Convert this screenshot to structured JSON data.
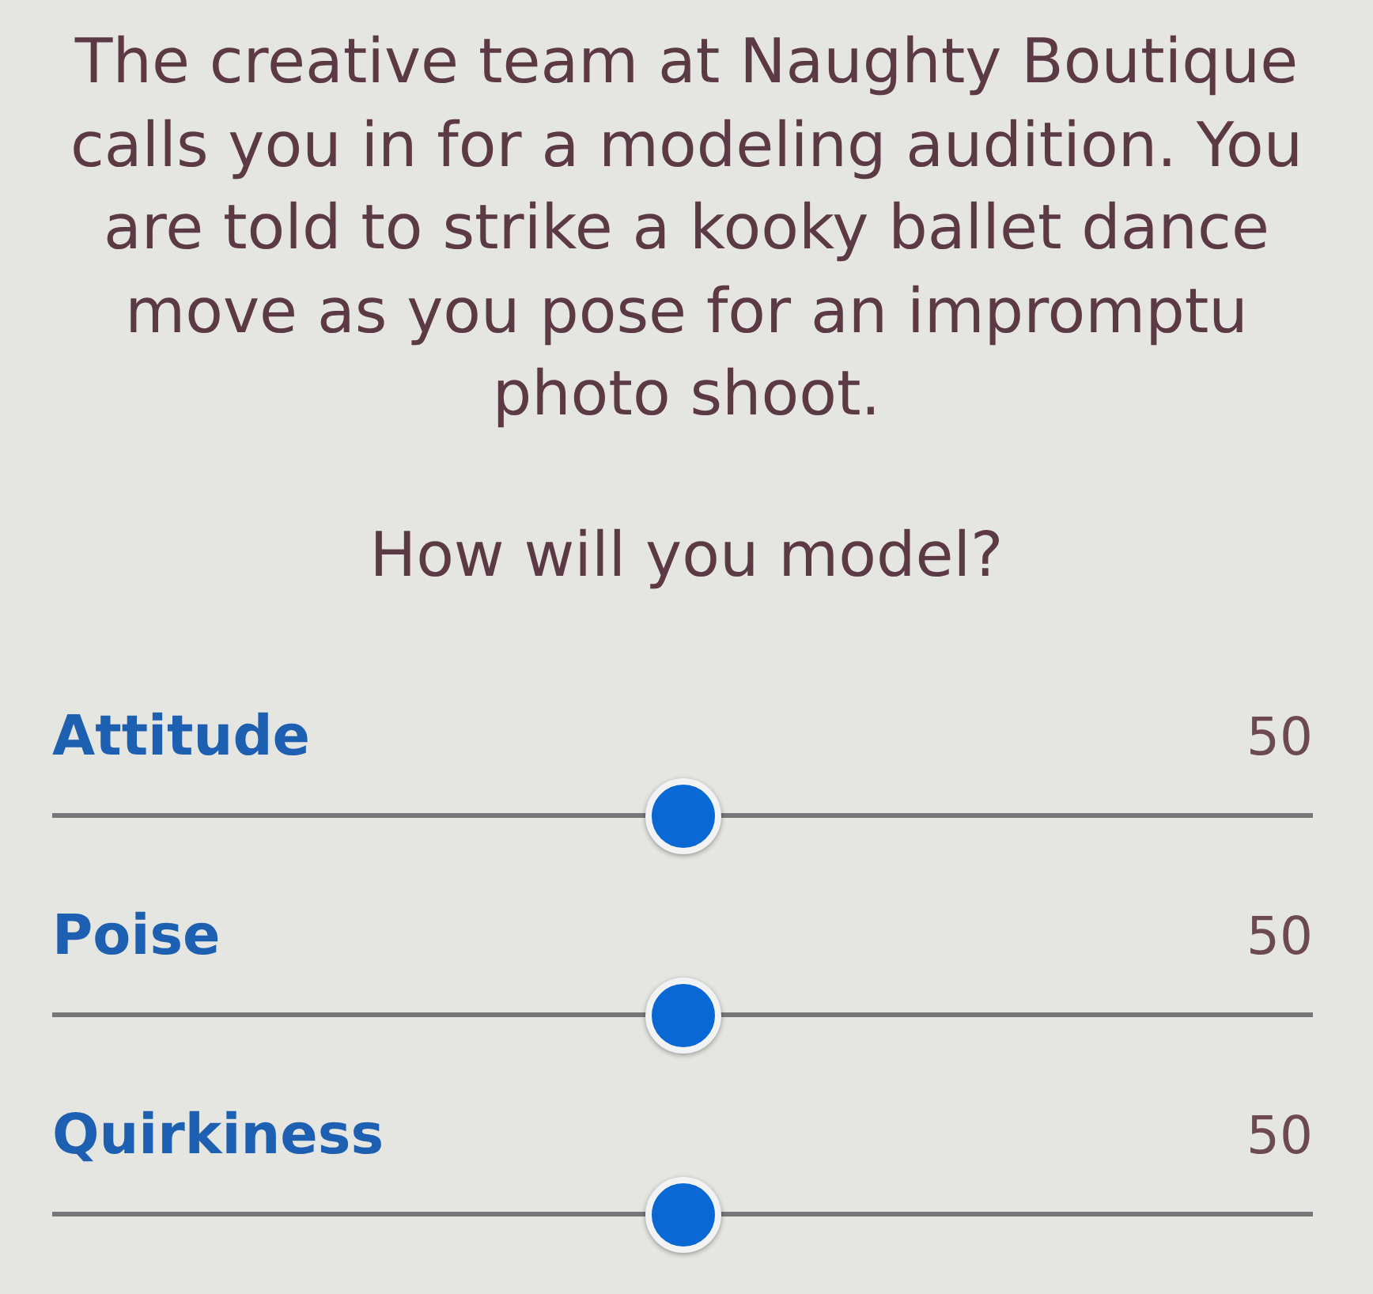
{
  "prompt": {
    "text": "The creative team at Naughty Boutique calls you in for a modeling audition. You are told to strike a kooky ballet dance move as you pose for an impromptu photo shoot.",
    "question": "How will you model?"
  },
  "sliders": [
    {
      "label": "Attitude",
      "reading": "50",
      "level": 0.5
    },
    {
      "label": "Poise",
      "reading": "50",
      "level": 0.5
    },
    {
      "label": "Quirkiness",
      "reading": "50",
      "level": 0.5
    }
  ]
}
